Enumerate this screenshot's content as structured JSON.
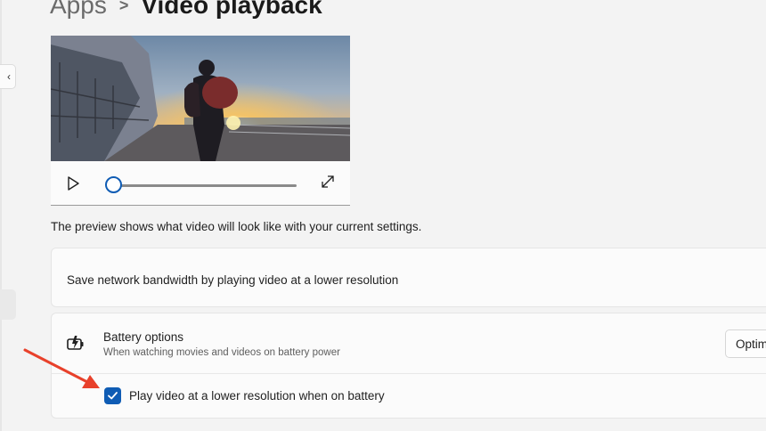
{
  "breadcrumb": {
    "parent": "Apps",
    "separator": ">",
    "current": "Video playback"
  },
  "player": {
    "progress": 0,
    "play_icon": "play-icon",
    "expand_icon": "expand-icon"
  },
  "preview_note": "The preview shows what video will look like with your current settings.",
  "bandwidth_card": {
    "label": "Save network bandwidth by playing video at a lower resolution"
  },
  "battery_card": {
    "icon": "battery-charging-icon",
    "title": "Battery options",
    "subtitle": "When watching movies and videos on battery power",
    "options_button": "Optim",
    "checkbox_label": "Play video at a lower resolution when on battery",
    "checkbox_checked": true
  },
  "annotation": {
    "arrow_color": "#e8412b"
  },
  "colors": {
    "accent": "#0f5cb4",
    "background": "#f3f3f3",
    "card": "#fbfbfb"
  }
}
